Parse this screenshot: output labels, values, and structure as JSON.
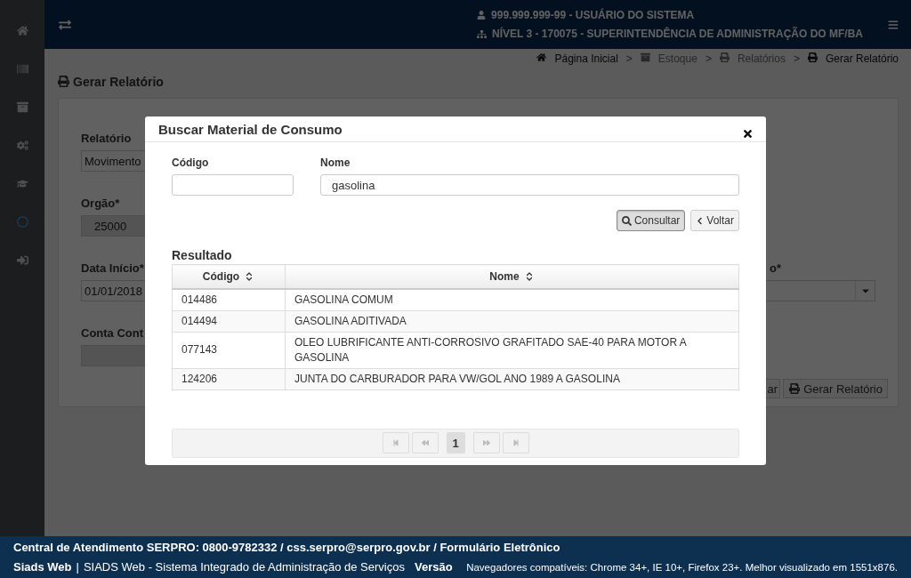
{
  "header": {
    "user": "999.999.999-99 - USUÁRIO DO SISTEMA",
    "unit": "NÍVEL 3 - 170075 - SUPERINTENDÊNCIA DE ADMINISTRAÇÃO DO MF/BA"
  },
  "page_title": "Gerar Relatório",
  "breadcrumb": {
    "separator": ">",
    "items": [
      {
        "label": "Página Inicial",
        "disabled": false
      },
      {
        "label": "Estoque",
        "disabled": true
      },
      {
        "label": "Relatórios",
        "disabled": true
      },
      {
        "label": "Gerar Relatório",
        "disabled": false
      }
    ]
  },
  "form": {
    "fields": [
      {
        "label": "Relatório",
        "value": "Movimento",
        "readonly": false
      },
      {
        "label": "Orgão*",
        "value": "25000",
        "readonly": true
      },
      {
        "label": "Data Início*",
        "value": "01/01/2018",
        "readonly": false
      },
      {
        "label": "Conta Cont",
        "readonly": true
      }
    ],
    "side_field": {
      "label": "o*",
      "kind": "select"
    },
    "buttons": [
      {
        "label": "ar",
        "kind": "plain"
      },
      {
        "label": "Gerar Relatório",
        "kind": "print"
      }
    ]
  },
  "modal": {
    "title": "Buscar Material de Consumo",
    "fields": [
      {
        "label": "Código",
        "wide": false
      },
      {
        "label": "Nome",
        "value": "gasolina",
        "wide": true
      }
    ],
    "buttons": [
      {
        "label": "Consultar",
        "kind": "search",
        "pressed": true
      },
      {
        "label": "Voltar",
        "kind": "back",
        "pressed": false
      }
    ],
    "results_title": "Resultado",
    "table": {
      "columns": [
        "Código",
        "Nome"
      ],
      "rows": [
        {
          "codigo": "014486",
          "nome": "GASOLINA COMUM"
        },
        {
          "codigo": "014494",
          "nome": "GASOLINA ADITIVADA"
        },
        {
          "codigo": "077143",
          "nome": "OLEO LUBRIFICANTE ANTI-CORROSIVO GRAFITADO SAE-40 PARA MOTOR A GASOLINA"
        },
        {
          "codigo": "124206",
          "nome": "JUNTA DO CARBURADOR PARA VW/GOL ANO 1989 A GASOLINA"
        }
      ]
    },
    "pagination": {
      "pages": [
        {
          "label": "1",
          "selected": true
        }
      ]
    }
  },
  "footer": {
    "contact": "Central de Atendimento SERPRO: 0800-9782332 / css.serpro@serpro.gov.br / Formulário Eletrônico",
    "brand": "Siads Web",
    "divider": "|",
    "system": "SIADS Web - Sistema Integrado de Administração de Serviços",
    "version": "Versão",
    "browsers": "Navegadores compatíveis: Chrome 34+, IE 10+, Firefox 23+. Melhor visualizado em 1551x876."
  }
}
